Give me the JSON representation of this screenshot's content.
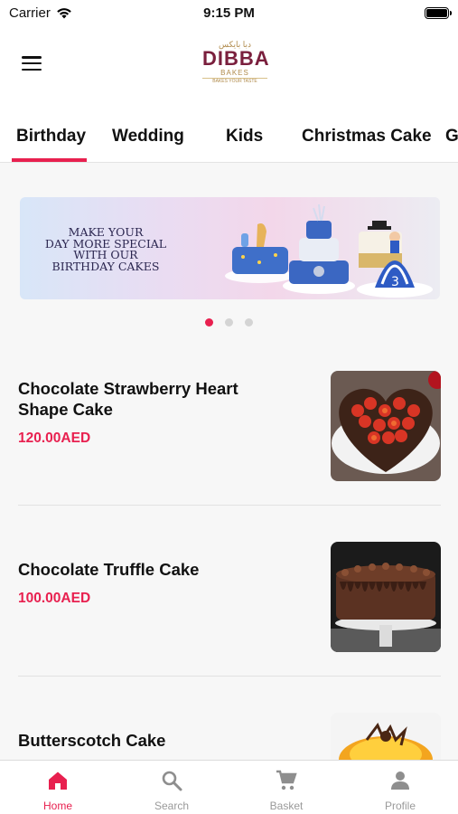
{
  "status_bar": {
    "carrier": "Carrier",
    "time": "9:15 PM"
  },
  "header": {
    "logo": {
      "arabic": "دبا بايكس",
      "brand": "DIBBA",
      "sub": "BAKES",
      "tagline": "BAKES YOUR TASTE"
    }
  },
  "tabs": [
    {
      "label": "Birthday",
      "active": true
    },
    {
      "label": "Wedding",
      "active": false
    },
    {
      "label": "Kids",
      "active": false
    },
    {
      "label": "Christmas Cake",
      "active": false
    },
    {
      "label": "Gr",
      "active": false
    }
  ],
  "banner": {
    "lines": [
      "MAKE YOUR",
      "DAY MORE SPECIAL",
      "WITH OUR",
      "BIRTHDAY CAKES"
    ],
    "slide_count": 3,
    "active_slide": 1
  },
  "products": [
    {
      "name": "Chocolate Strawberry Heart Shape Cake",
      "price": "120.00AED",
      "image": "strawberry-heart-cake"
    },
    {
      "name": "Chocolate Truffle Cake",
      "price": "100.00AED",
      "image": "chocolate-truffle-cake"
    },
    {
      "name": "Butterscotch Cake",
      "price": "",
      "image": "butterscotch-cake"
    }
  ],
  "bottom_nav": [
    {
      "label": "Home",
      "icon": "home-icon",
      "active": true
    },
    {
      "label": "Search",
      "icon": "search-icon",
      "active": false
    },
    {
      "label": "Basket",
      "icon": "cart-icon",
      "active": false
    },
    {
      "label": "Profile",
      "icon": "person-icon",
      "active": false
    }
  ],
  "colors": {
    "accent": "#e8204f",
    "brand": "#7a1f3d",
    "inactive": "#9a9a9a"
  }
}
